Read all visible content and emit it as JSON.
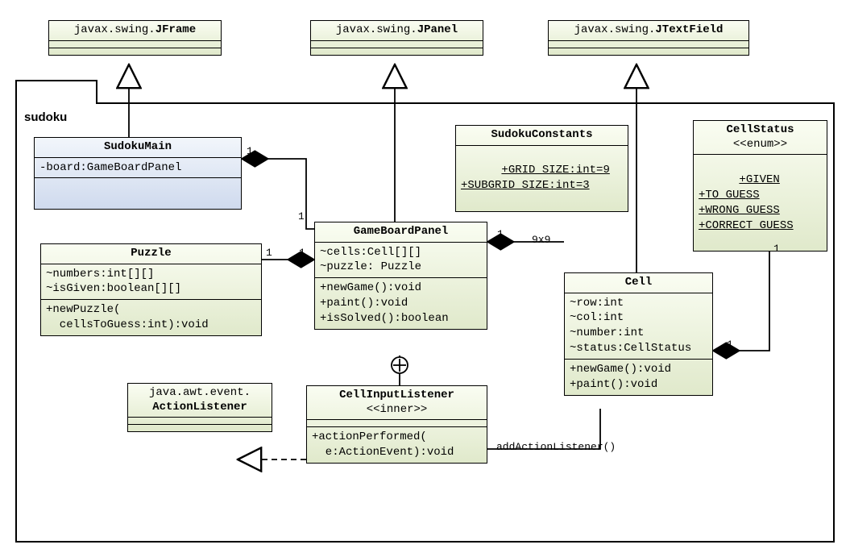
{
  "package": {
    "name": "sudoku"
  },
  "classes": {
    "jframe": {
      "pkg": "javax.swing.",
      "name": "JFrame"
    },
    "jpanel": {
      "pkg": "javax.swing.",
      "name": "JPanel"
    },
    "jtextfield": {
      "pkg": "javax.swing.",
      "name": "JTextField"
    },
    "sudokumain": {
      "name": "SudokuMain",
      "attrs": [
        "-board:GameBoardPanel"
      ]
    },
    "sudokuconstants": {
      "name": "SudokuConstants",
      "attrs_u": [
        "+GRID_SIZE:int=9",
        "+SUBGRID_SIZE:int=3"
      ]
    },
    "cellstatus": {
      "name": "CellStatus",
      "stereo": "<<enum>>",
      "attrs_u": [
        "+GIVEN",
        "+TO_GUESS",
        "+WRONG_GUESS",
        "+CORRECT_GUESS"
      ]
    },
    "puzzle": {
      "name": "Puzzle",
      "attrs": [
        "~numbers:int[][]",
        "~isGiven:boolean[][]"
      ],
      "ops": [
        "+newPuzzle(",
        "  cellsToGuess:int):void"
      ]
    },
    "gameboardpanel": {
      "name": "GameBoardPanel",
      "attrs": [
        "~cells:Cell[][]",
        "~puzzle: Puzzle"
      ],
      "ops": [
        "+newGame():void",
        "+paint():void",
        "+isSolved():boolean"
      ]
    },
    "cell": {
      "name": "Cell",
      "attrs": [
        "~row:int",
        "~col:int",
        "~number:int",
        "~status:CellStatus"
      ],
      "ops": [
        "+newGame():void",
        "+paint():void"
      ]
    },
    "actionlistener": {
      "pkg": "java.awt.event.",
      "name": "ActionListener"
    },
    "cellinputlistener": {
      "name": "CellInputListener",
      "stereo": "<<inner>>",
      "ops": [
        "+actionPerformed(",
        "  e:ActionEvent):void"
      ]
    }
  },
  "labels": {
    "one_a": "1",
    "one_b": "1",
    "one_c": "1",
    "one_d": "1",
    "one_e": "1",
    "one_f": "1",
    "one_g": "1",
    "nine": "9x9",
    "addAL": "addActionListener()"
  }
}
